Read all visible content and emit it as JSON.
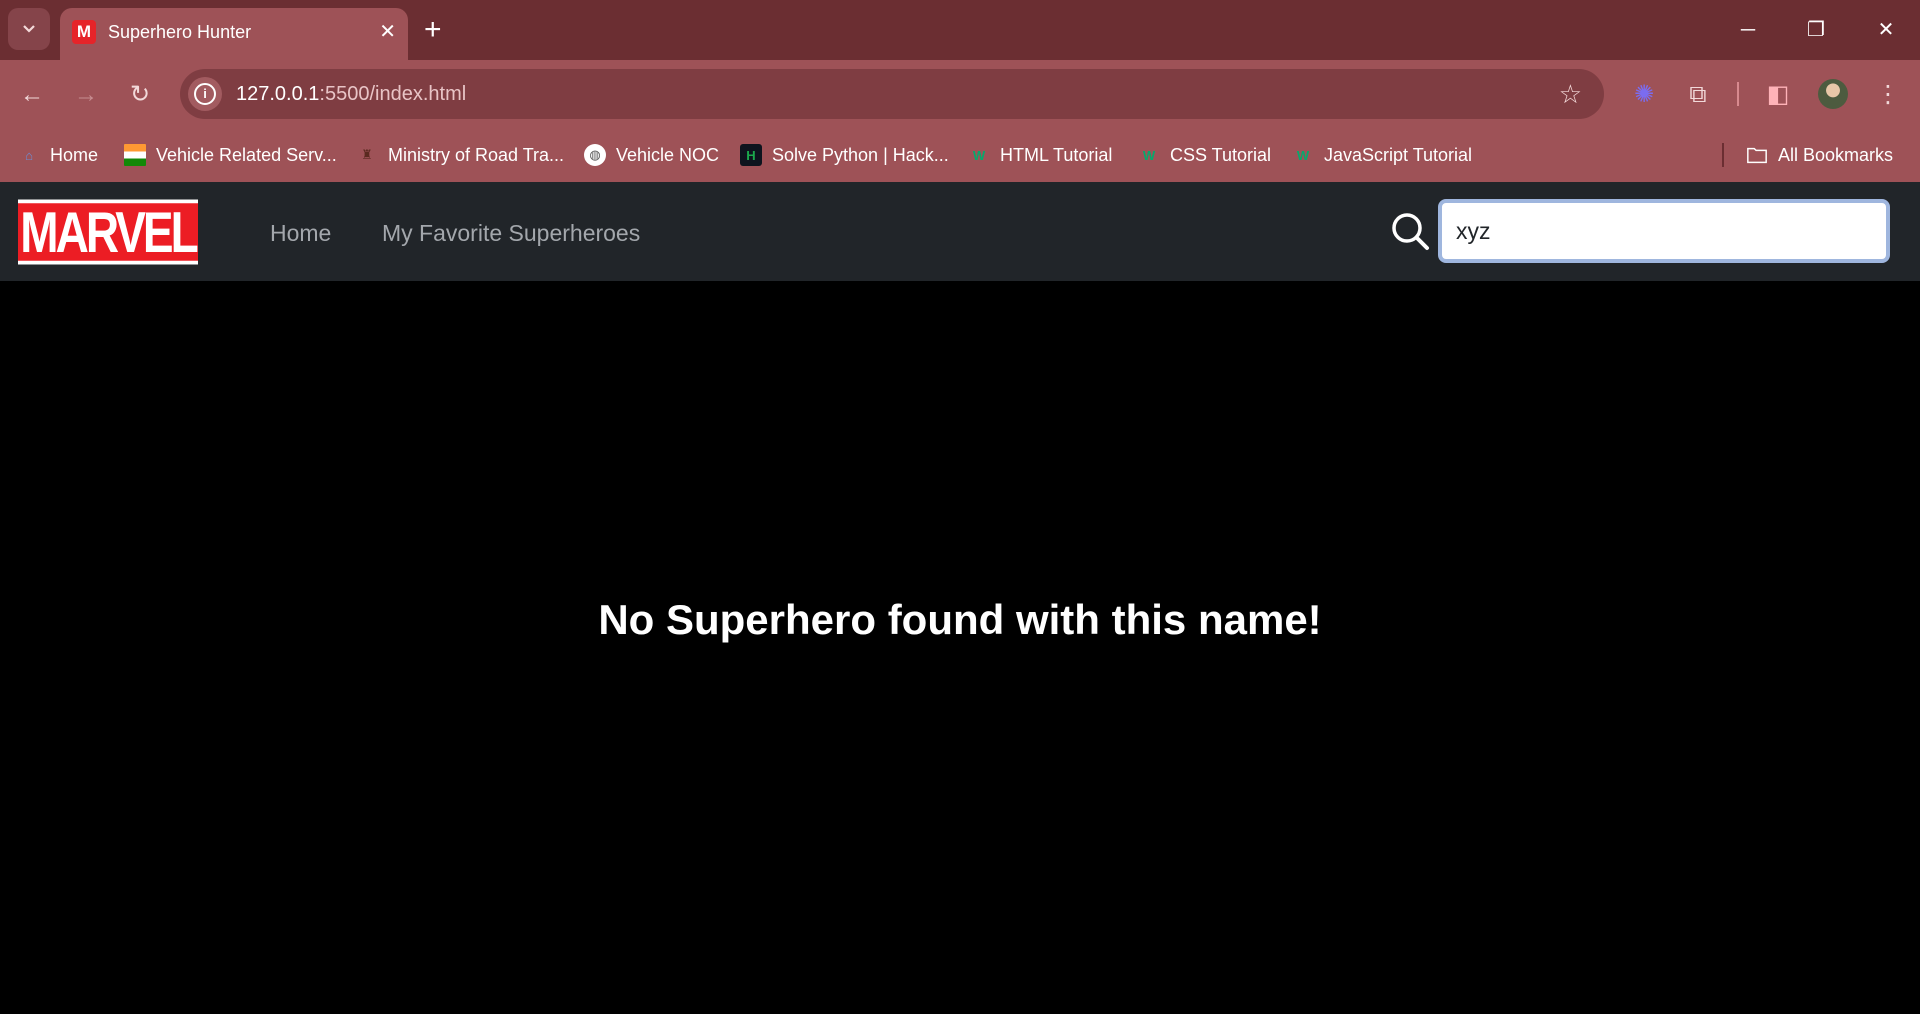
{
  "browser": {
    "tab_title": "Superhero Hunter",
    "tab_favicon": "M",
    "url_host": "127.0.0.1",
    "url_rest": ":5500/index.html",
    "bookmarks": [
      {
        "label": "Home",
        "icon": "house-icon"
      },
      {
        "label": "Vehicle Related Serv...",
        "icon": "india-flag-icon"
      },
      {
        "label": "Ministry of Road Tra...",
        "icon": "emblem-icon"
      },
      {
        "label": "Vehicle NOC",
        "icon": "globe-icon"
      },
      {
        "label": "Solve Python | Hack...",
        "icon": "hackerrank-icon"
      },
      {
        "label": "HTML Tutorial",
        "icon": "w3schools-icon"
      },
      {
        "label": "CSS Tutorial",
        "icon": "w3schools-icon"
      },
      {
        "label": "JavaScript Tutorial",
        "icon": "w3schools-icon"
      }
    ],
    "all_bookmarks": "All Bookmarks"
  },
  "navbar": {
    "logo_text": "MARVEL",
    "links": [
      "Home",
      "My Favorite Superheroes"
    ],
    "search_value": "xyz"
  },
  "main": {
    "message": "No Superhero found with this name!"
  },
  "colors": {
    "brand": "#ec1d24",
    "navbar_bg": "#212529",
    "chrome_frame": "#6b2e32",
    "chrome_toolbar": "#9e5257"
  }
}
